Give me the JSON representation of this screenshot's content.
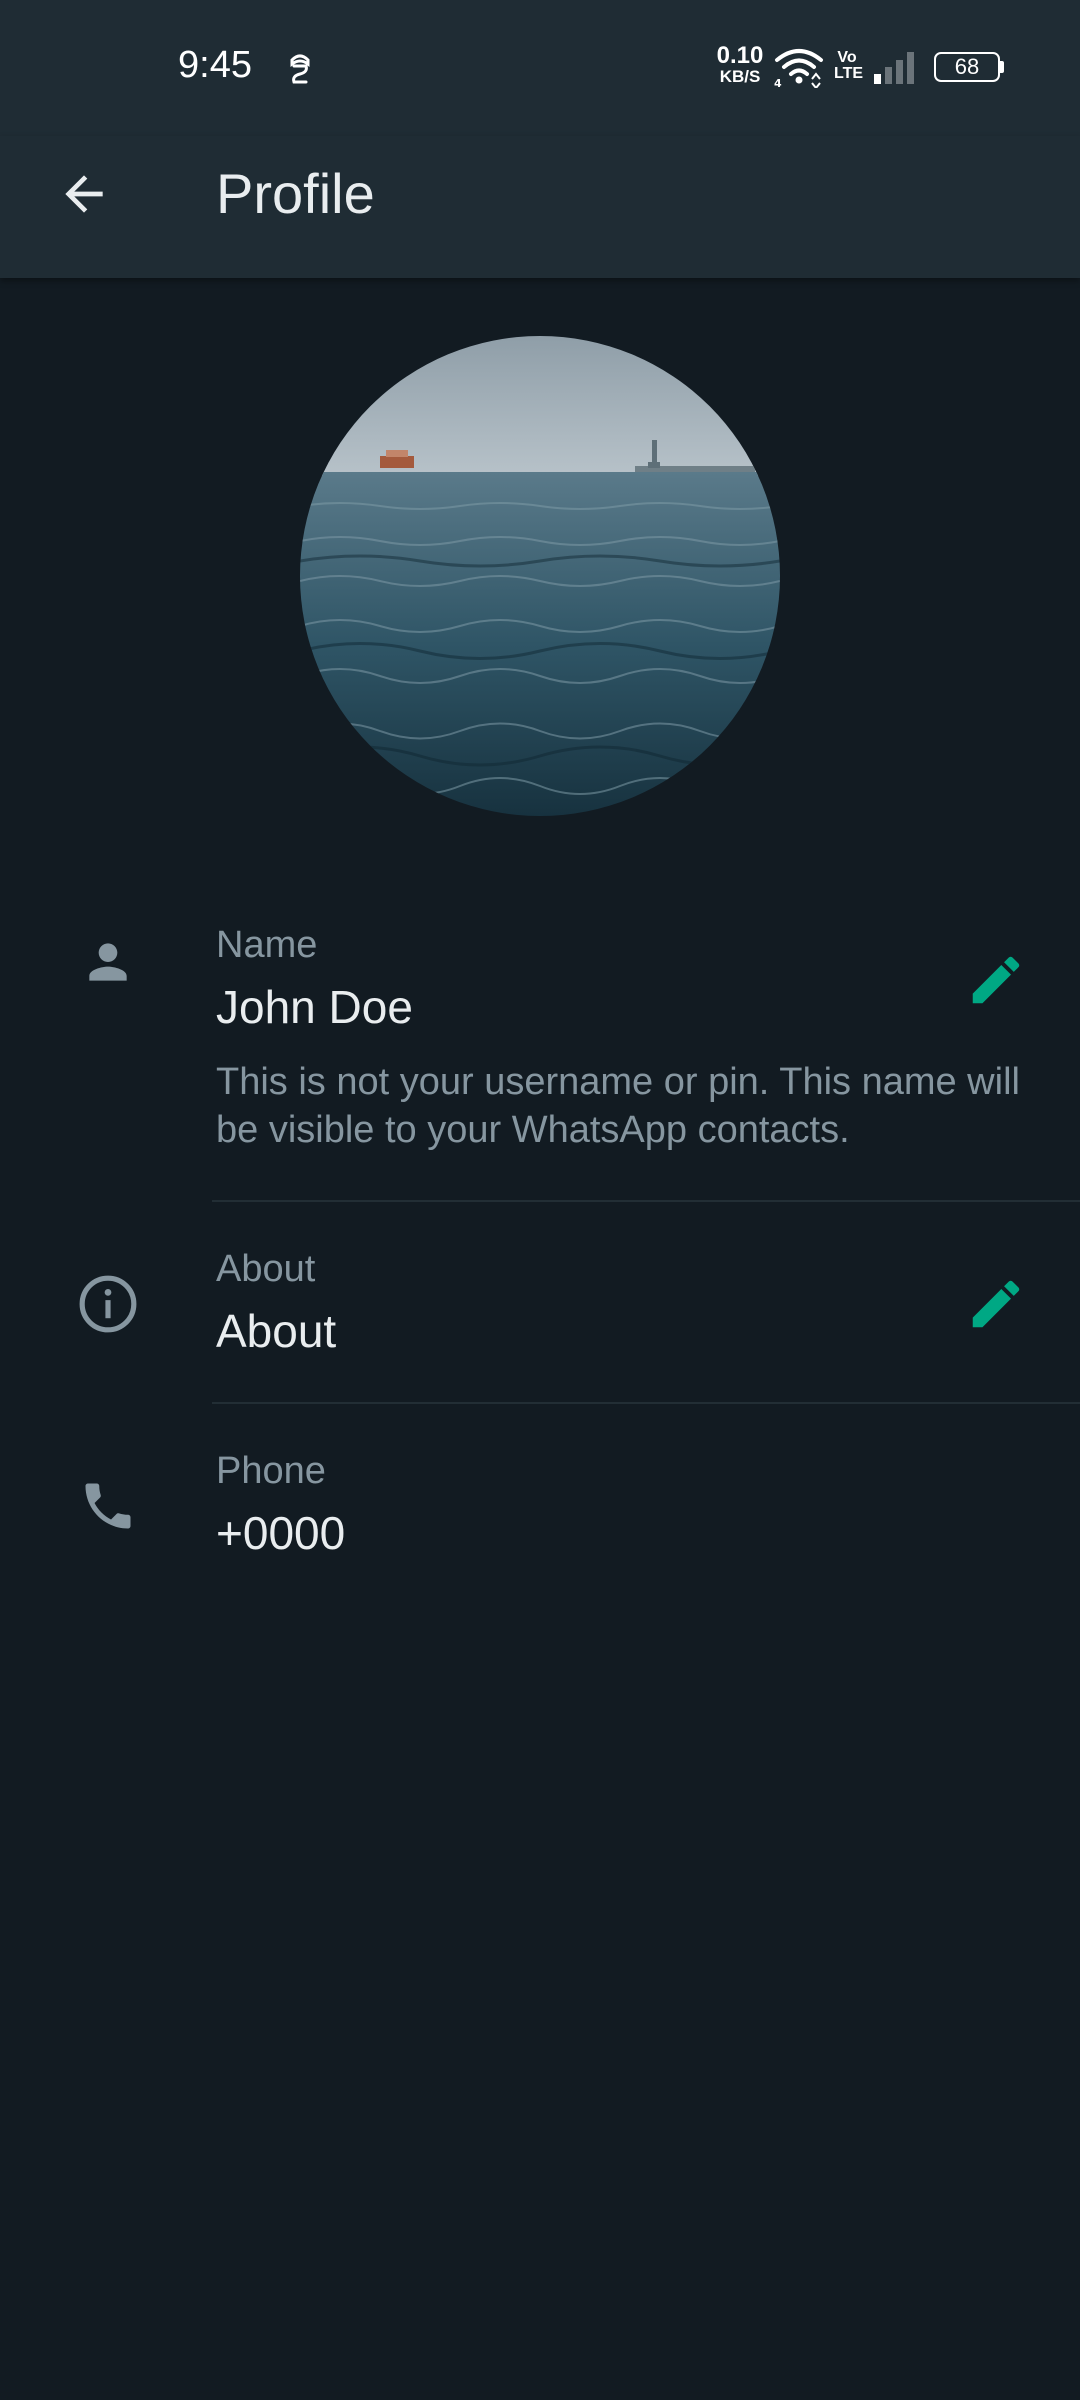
{
  "status_bar": {
    "time": "9:45",
    "net_speed_value": "0.10",
    "net_speed_unit": "KB/S",
    "volte_top": "Vo",
    "volte_bottom": "LTE",
    "battery": "68"
  },
  "header": {
    "title": "Profile",
    "back_icon": "arrow-left-icon"
  },
  "profile": {
    "photo": "profile-photo",
    "name": {
      "label": "Name",
      "value": "John Doe",
      "helper": "This is not your username or pin. This name will be visible to your WhatsApp contacts.",
      "icon": "person-icon",
      "edit_icon": "pencil-icon"
    },
    "about": {
      "label": "About",
      "value": "About",
      "icon": "info-icon",
      "edit_icon": "pencil-icon"
    },
    "phone": {
      "label": "Phone",
      "value": "+0000",
      "icon": "phone-icon"
    }
  },
  "colors": {
    "background": "#121b22",
    "bar": "#1f2c34",
    "accent": "#00a884",
    "secondary_text": "#8696a0",
    "primary_text": "#e9edef"
  }
}
